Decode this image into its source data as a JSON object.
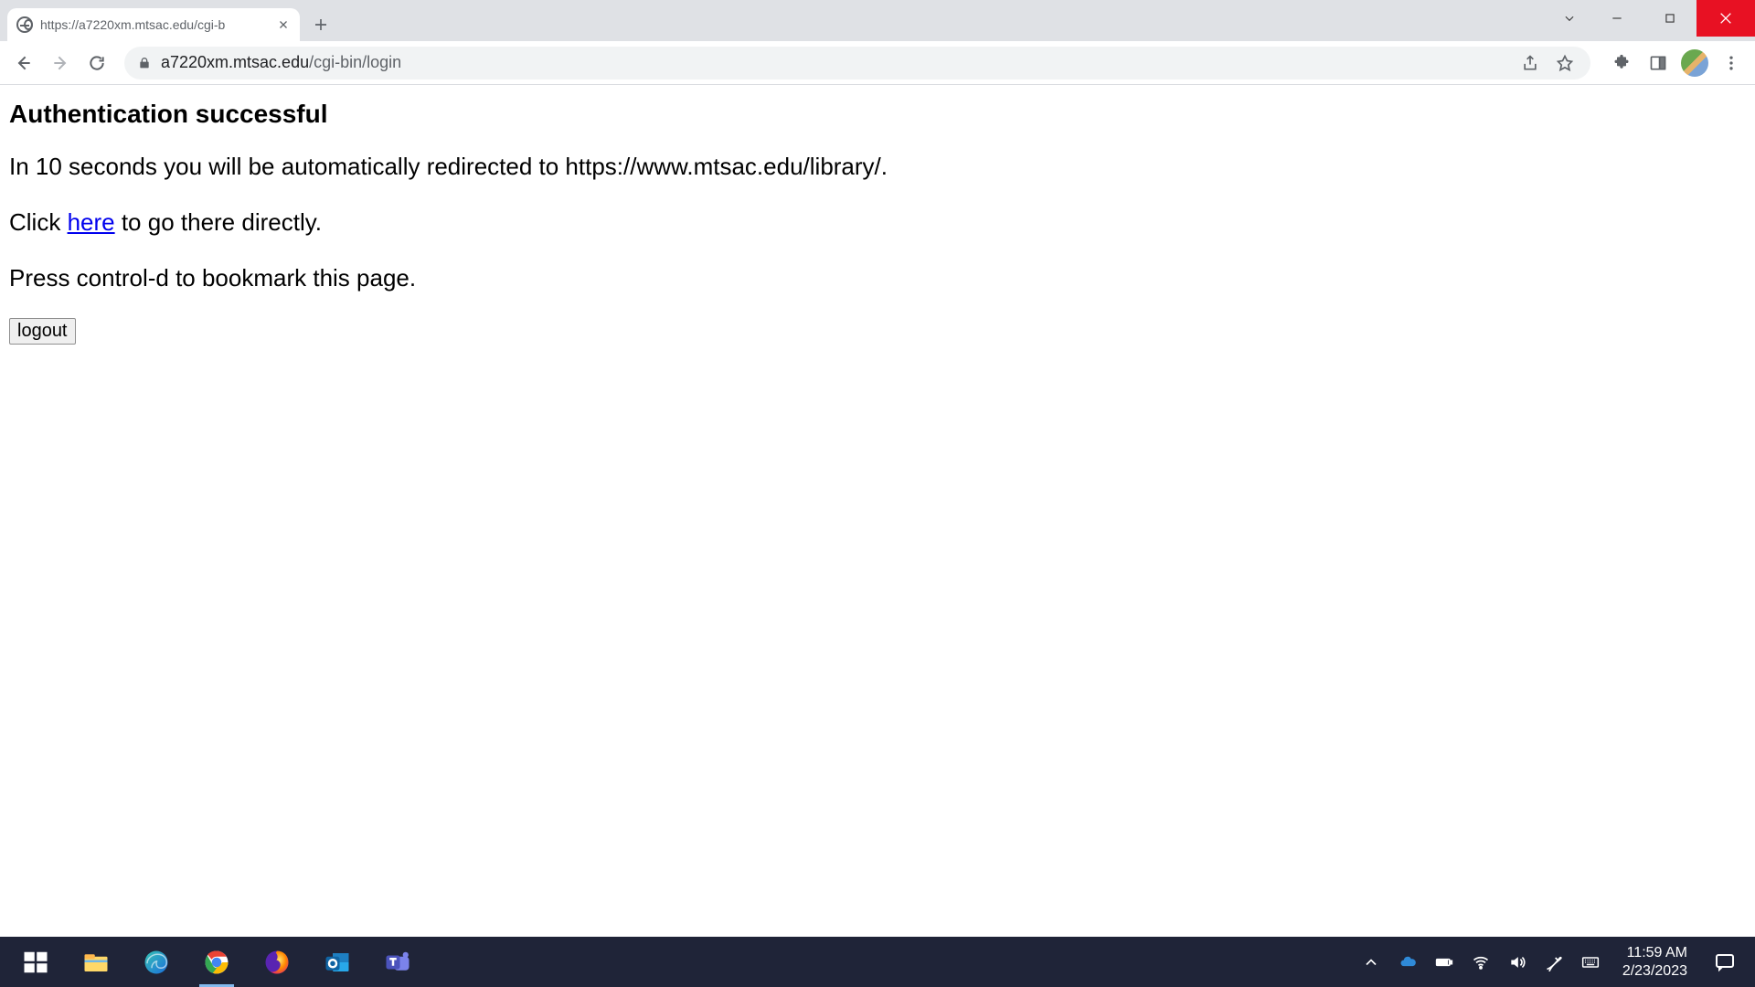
{
  "browser": {
    "tab_title": "https://a7220xm.mtsac.edu/cgi-b",
    "url_host": "a7220xm.mtsac.edu",
    "url_path": "/cgi-bin/login"
  },
  "page": {
    "heading": "Authentication successful",
    "redirect_text": "In 10 seconds you will be automatically redirected to https://www.mtsac.edu/library/.",
    "click_prefix": "Click ",
    "here_link": "here",
    "click_suffix": " to go there directly.",
    "bookmark_text": "Press control-d to bookmark this page.",
    "logout_label": "logout"
  },
  "taskbar": {
    "time": "11:59 AM",
    "date": "2/23/2023"
  }
}
